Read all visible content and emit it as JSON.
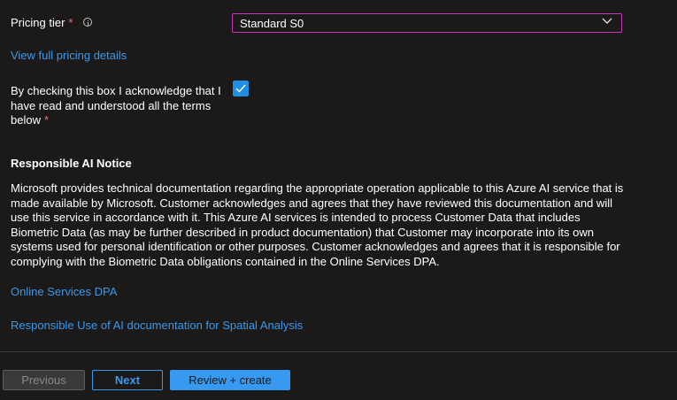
{
  "pricing": {
    "label": "Pricing tier",
    "required_mark": "*",
    "selected_value": "Standard S0",
    "view_details_link": "View full pricing details"
  },
  "acknowledgement": {
    "text": "By checking this box I acknowledge that I have read and understood all the terms below",
    "required_mark": "*",
    "checked": true
  },
  "notice": {
    "heading": "Responsible AI Notice",
    "body": "Microsoft provides technical documentation regarding the appropriate operation applicable to this Azure AI service that is made available by Microsoft. Customer acknowledges and agrees that they have reviewed this documentation and will use this service in accordance with it. This Azure AI services is intended to process Customer Data that includes Biometric Data (as may be further described in product documentation) that Customer may incorporate into its own systems used for personal identification or other purposes. Customer acknowledges and agrees that it is responsible for complying with the Biometric Data obligations contained in the Online Services DPA.",
    "link_dpa": "Online Services DPA",
    "link_responsible_use": "Responsible Use of AI documentation for Spatial Analysis"
  },
  "footer": {
    "previous_label": "Previous",
    "next_label": "Next",
    "create_label": "Review + create"
  },
  "colors": {
    "background": "#1b1a19",
    "link": "#3899f0",
    "required": "#f1707b",
    "focus_border": "#c239b3",
    "checkbox": "#1f8fe6"
  }
}
